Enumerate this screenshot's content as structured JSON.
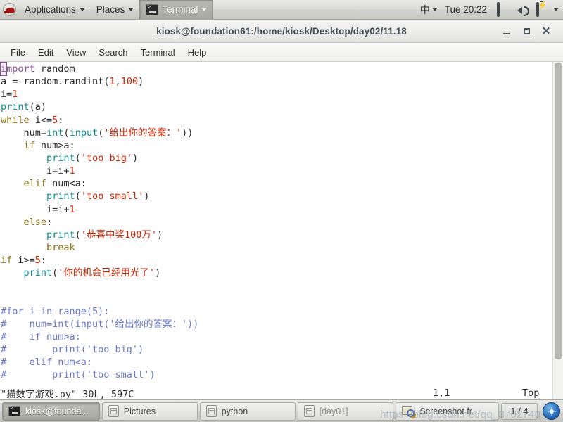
{
  "top_panel": {
    "logo_icon": "redhat-logo-icon",
    "applications_label": "Applications",
    "places_label": "Places",
    "active_window_label": "Terminal",
    "ime_indicator": "中",
    "clock": "Tue 20:22",
    "tray_icons": [
      "display-icon",
      "volume-icon",
      "battery-icon"
    ],
    "tray_caret": "chevron-down-icon"
  },
  "window": {
    "title": "kiosk@foundation61:/home/kiosk/Desktop/day02/11.18",
    "buttons": {
      "minimize": "–",
      "maximize": "□",
      "close": "✕"
    },
    "menubar": [
      "File",
      "Edit",
      "View",
      "Search",
      "Terminal",
      "Help"
    ]
  },
  "editor": {
    "filename_status": "\"猫数字游戏.py\" 30L, 597C",
    "cursor_position": "1,1",
    "scroll_position": "Top",
    "lines": [
      [
        {
          "t": "import",
          "c": "tok-import",
          "cursor": true
        },
        {
          "t": " random",
          "c": "tok-plain"
        }
      ],
      [
        {
          "t": "a = random.randint(",
          "c": "tok-plain"
        },
        {
          "t": "1",
          "c": "tok-num"
        },
        {
          "t": ",",
          "c": "tok-plain"
        },
        {
          "t": "100",
          "c": "tok-num"
        },
        {
          "t": ")",
          "c": "tok-plain"
        }
      ],
      [
        {
          "t": "i=",
          "c": "tok-plain"
        },
        {
          "t": "1",
          "c": "tok-num"
        }
      ],
      [
        {
          "t": "print",
          "c": "tok-builtin"
        },
        {
          "t": "(a)",
          "c": "tok-plain"
        }
      ],
      [
        {
          "t": "while",
          "c": "tok-kw"
        },
        {
          "t": " i<=",
          "c": "tok-plain"
        },
        {
          "t": "5",
          "c": "tok-num"
        },
        {
          "t": ":",
          "c": "tok-plain"
        }
      ],
      [
        {
          "t": "    num=",
          "c": "tok-plain"
        },
        {
          "t": "int",
          "c": "tok-builtin"
        },
        {
          "t": "(",
          "c": "tok-plain"
        },
        {
          "t": "input",
          "c": "tok-builtin"
        },
        {
          "t": "(",
          "c": "tok-plain"
        },
        {
          "t": "'给出你的答案：'",
          "c": "tok-str"
        },
        {
          "t": "))",
          "c": "tok-plain"
        }
      ],
      [
        {
          "t": "    ",
          "c": "tok-plain"
        },
        {
          "t": "if",
          "c": "tok-kw"
        },
        {
          "t": " num>a:",
          "c": "tok-plain"
        }
      ],
      [
        {
          "t": "        ",
          "c": "tok-plain"
        },
        {
          "t": "print",
          "c": "tok-builtin"
        },
        {
          "t": "(",
          "c": "tok-plain"
        },
        {
          "t": "'too big'",
          "c": "tok-str"
        },
        {
          "t": ")",
          "c": "tok-plain"
        }
      ],
      [
        {
          "t": "        i=i+",
          "c": "tok-plain"
        },
        {
          "t": "1",
          "c": "tok-num"
        }
      ],
      [
        {
          "t": "    ",
          "c": "tok-plain"
        },
        {
          "t": "elif",
          "c": "tok-kw"
        },
        {
          "t": " num<a:",
          "c": "tok-plain"
        }
      ],
      [
        {
          "t": "        ",
          "c": "tok-plain"
        },
        {
          "t": "print",
          "c": "tok-builtin"
        },
        {
          "t": "(",
          "c": "tok-plain"
        },
        {
          "t": "'too small'",
          "c": "tok-str"
        },
        {
          "t": ")",
          "c": "tok-plain"
        }
      ],
      [
        {
          "t": "        i=i+",
          "c": "tok-plain"
        },
        {
          "t": "1",
          "c": "tok-num"
        }
      ],
      [
        {
          "t": "    ",
          "c": "tok-plain"
        },
        {
          "t": "else",
          "c": "tok-kw"
        },
        {
          "t": ":",
          "c": "tok-plain"
        }
      ],
      [
        {
          "t": "        ",
          "c": "tok-plain"
        },
        {
          "t": "print",
          "c": "tok-builtin"
        },
        {
          "t": "(",
          "c": "tok-plain"
        },
        {
          "t": "'恭喜中奖100万'",
          "c": "tok-str"
        },
        {
          "t": ")",
          "c": "tok-plain"
        }
      ],
      [
        {
          "t": "        ",
          "c": "tok-plain"
        },
        {
          "t": "break",
          "c": "tok-kw"
        }
      ],
      [
        {
          "t": "if",
          "c": "tok-kw"
        },
        {
          "t": " i>=",
          "c": "tok-plain"
        },
        {
          "t": "5",
          "c": "tok-num"
        },
        {
          "t": ":",
          "c": "tok-plain"
        }
      ],
      [
        {
          "t": "    ",
          "c": "tok-plain"
        },
        {
          "t": "print",
          "c": "tok-builtin"
        },
        {
          "t": "(",
          "c": "tok-plain"
        },
        {
          "t": "'你的机会已经用光了'",
          "c": "tok-str"
        },
        {
          "t": ")",
          "c": "tok-plain"
        }
      ],
      [],
      [],
      [
        {
          "t": "#for i in range(5):",
          "c": "tok-comment"
        }
      ],
      [
        {
          "t": "#    num=int(input('给出你的答案：'))",
          "c": "tok-comment"
        }
      ],
      [
        {
          "t": "#    if num>a:",
          "c": "tok-comment"
        }
      ],
      [
        {
          "t": "#        print('too big')",
          "c": "tok-comment"
        }
      ],
      [
        {
          "t": "#    elif num<a:",
          "c": "tok-comment"
        }
      ],
      [
        {
          "t": "#        print('too small')",
          "c": "tok-comment"
        }
      ]
    ]
  },
  "taskbar": {
    "items": [
      {
        "label": "kiosk@founda...",
        "icon": "terminal-icon",
        "active": true,
        "dim": false,
        "w": "w1"
      },
      {
        "label": "Pictures",
        "icon": "files-icon",
        "active": false,
        "dim": false,
        "w": "w2"
      },
      {
        "label": "python",
        "icon": "files-icon",
        "active": false,
        "dim": false,
        "w": "w3"
      },
      {
        "label": "[day01]",
        "icon": "files-icon",
        "active": false,
        "dim": true,
        "w": "w4"
      },
      {
        "label": "Screenshot fr...",
        "icon": "screenshot-icon",
        "active": false,
        "dim": false,
        "w": "w5"
      }
    ],
    "workspace_indicator": "1 / 4",
    "help_icon": "help-orb-icon"
  },
  "watermark": {
    "text": "https://blog.csdn.net/qq_3702740"
  }
}
